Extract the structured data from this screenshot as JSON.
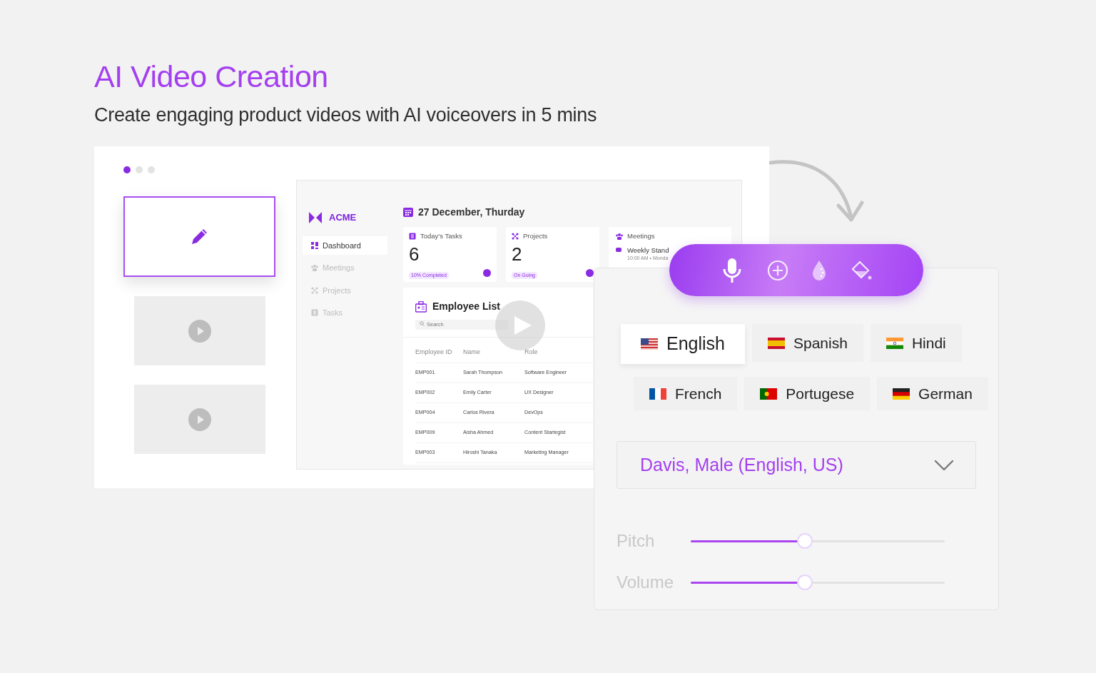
{
  "header": {
    "title": "AI Video Creation",
    "subtitle": "Create engaging product videos with AI voiceovers in 5 mins"
  },
  "carousel_dots": [
    {
      "selected": true
    },
    {
      "selected": false
    },
    {
      "selected": false
    }
  ],
  "slides": [
    {
      "kind": "edit",
      "selected": true
    },
    {
      "kind": "video",
      "selected": false
    },
    {
      "kind": "video",
      "selected": false
    }
  ],
  "dashboard": {
    "brand": "ACME",
    "nav": [
      {
        "label": "Dashboard",
        "kind": "grid",
        "selected": true
      },
      {
        "label": "Meetings",
        "kind": "people",
        "selected": false
      },
      {
        "label": "Projects",
        "kind": "nodes",
        "selected": false
      },
      {
        "label": "Tasks",
        "kind": "list",
        "selected": false
      }
    ],
    "date": "27 December, Thurday",
    "stats": [
      {
        "title": "Today's Tasks",
        "kind": "list",
        "value": "6",
        "tag": "10% Completed"
      },
      {
        "title": "Projects",
        "kind": "nodes",
        "value": "2",
        "tag": "On Going"
      }
    ],
    "meetings": {
      "title": "Meetings",
      "event": "Weekly Stand",
      "time": "10:00 AM • Monda"
    },
    "employee_list": {
      "title": "Employee List",
      "search_placeholder": "Search",
      "columns": [
        "Employee ID",
        "Name",
        "Role"
      ],
      "rows": [
        [
          "EMP001",
          "Sarah Thompson",
          "Software Engineer"
        ],
        [
          "EMP002",
          "Emily Carter",
          "UX Designer"
        ],
        [
          "EMP004",
          "Carlos Rivera",
          "DevOps"
        ],
        [
          "EMP009",
          "Aisha Ahmed",
          "Content Startegist"
        ],
        [
          "EMP003",
          "Hiroshi Tanaka",
          "Marketing Manager"
        ]
      ]
    }
  },
  "voice_panel": {
    "tools": [
      {
        "kind": "mic"
      },
      {
        "kind": "add"
      },
      {
        "kind": "drop"
      },
      {
        "kind": "bucket"
      }
    ],
    "languages": [
      {
        "label": "English",
        "kind": "us",
        "selected": true
      },
      {
        "label": "Spanish",
        "kind": "es",
        "selected": false
      },
      {
        "label": "Hindi",
        "kind": "in",
        "selected": false
      },
      {
        "label": "French",
        "kind": "fr",
        "selected": false
      },
      {
        "label": "Portugese",
        "kind": "pt",
        "selected": false
      },
      {
        "label": "German",
        "kind": "de",
        "selected": false
      }
    ],
    "voice": "Davis, Male (English, US)",
    "sliders": [
      {
        "label": "Pitch",
        "level": 0.45
      },
      {
        "label": "Volume",
        "level": 0.45
      }
    ]
  }
}
